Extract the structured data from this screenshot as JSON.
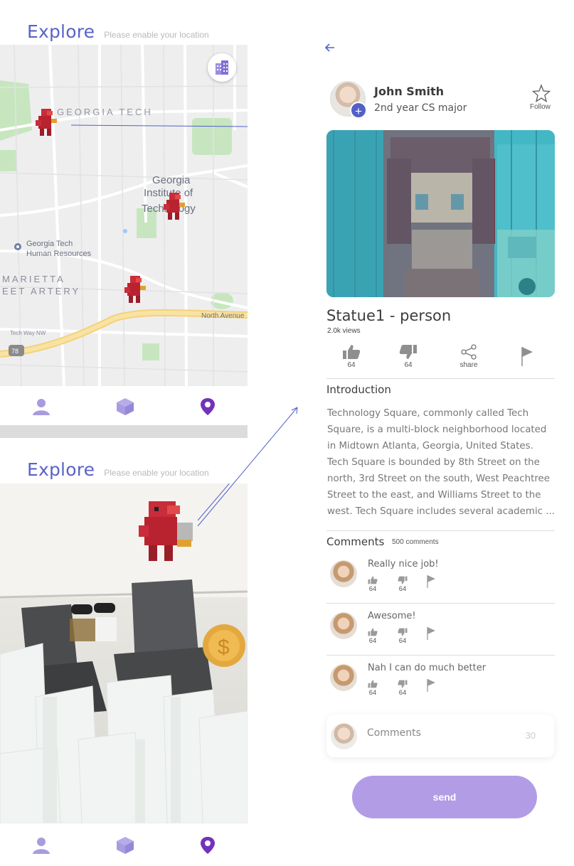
{
  "explore_top": {
    "title": "Explore",
    "subtitle": "Please enable your location"
  },
  "explore_bottom": {
    "title": "Explore",
    "subtitle": "Please enable your location"
  },
  "map": {
    "labels": {
      "campus": "GEORGIA TECH",
      "institute_line1": "Georgia",
      "institute_line2": "Institute of",
      "institute_line3": "Technology",
      "poi_line1": "Georgia Tech",
      "poi_line2": "Human Resources",
      "artery_line1": "MARIETTA",
      "artery_line2": "EET ARTERY",
      "north_ave": "North Avenue",
      "tech_way": "Tech Way NW",
      "route": "78"
    }
  },
  "nav": {
    "items": [
      "profile",
      "ar",
      "map"
    ]
  },
  "detail": {
    "user": {
      "name": "John Smith",
      "role": "2nd year CS major"
    },
    "follow_label": "Follow",
    "title": "Statue1 - person",
    "views": "2.0k views",
    "actions": {
      "like_count": "64",
      "dislike_count": "64",
      "share_label": "share"
    },
    "introduction_title": "Introduction",
    "introduction_text": "Technology Square, commonly called Tech Square, is a multi-block neighborhood located in Midtown Atlanta, Georgia, United States. Tech Square is bounded by 8th Street on the north, 3rd Street on the south, West Peachtree Street to the east, and Williams Street to the west. Tech Square includes several academic ...",
    "comments_title": "Comments",
    "comments_count": "500 comments",
    "comments": [
      {
        "text": "Really nice job!",
        "likes": "64",
        "dislikes": "64"
      },
      {
        "text": "Awesome!",
        "likes": "64",
        "dislikes": "64"
      },
      {
        "text": "Nah I can do much better",
        "likes": "64",
        "dislikes": "64"
      }
    ],
    "comment_input": {
      "placeholder": "Comments",
      "limit": "30"
    },
    "send_label": "send"
  },
  "colors": {
    "accent": "#5a63c8",
    "nav_active": "#7233b9",
    "nav_inactive": "#a99be0",
    "send": "#b29ce6",
    "dino": "#c92c3a"
  }
}
